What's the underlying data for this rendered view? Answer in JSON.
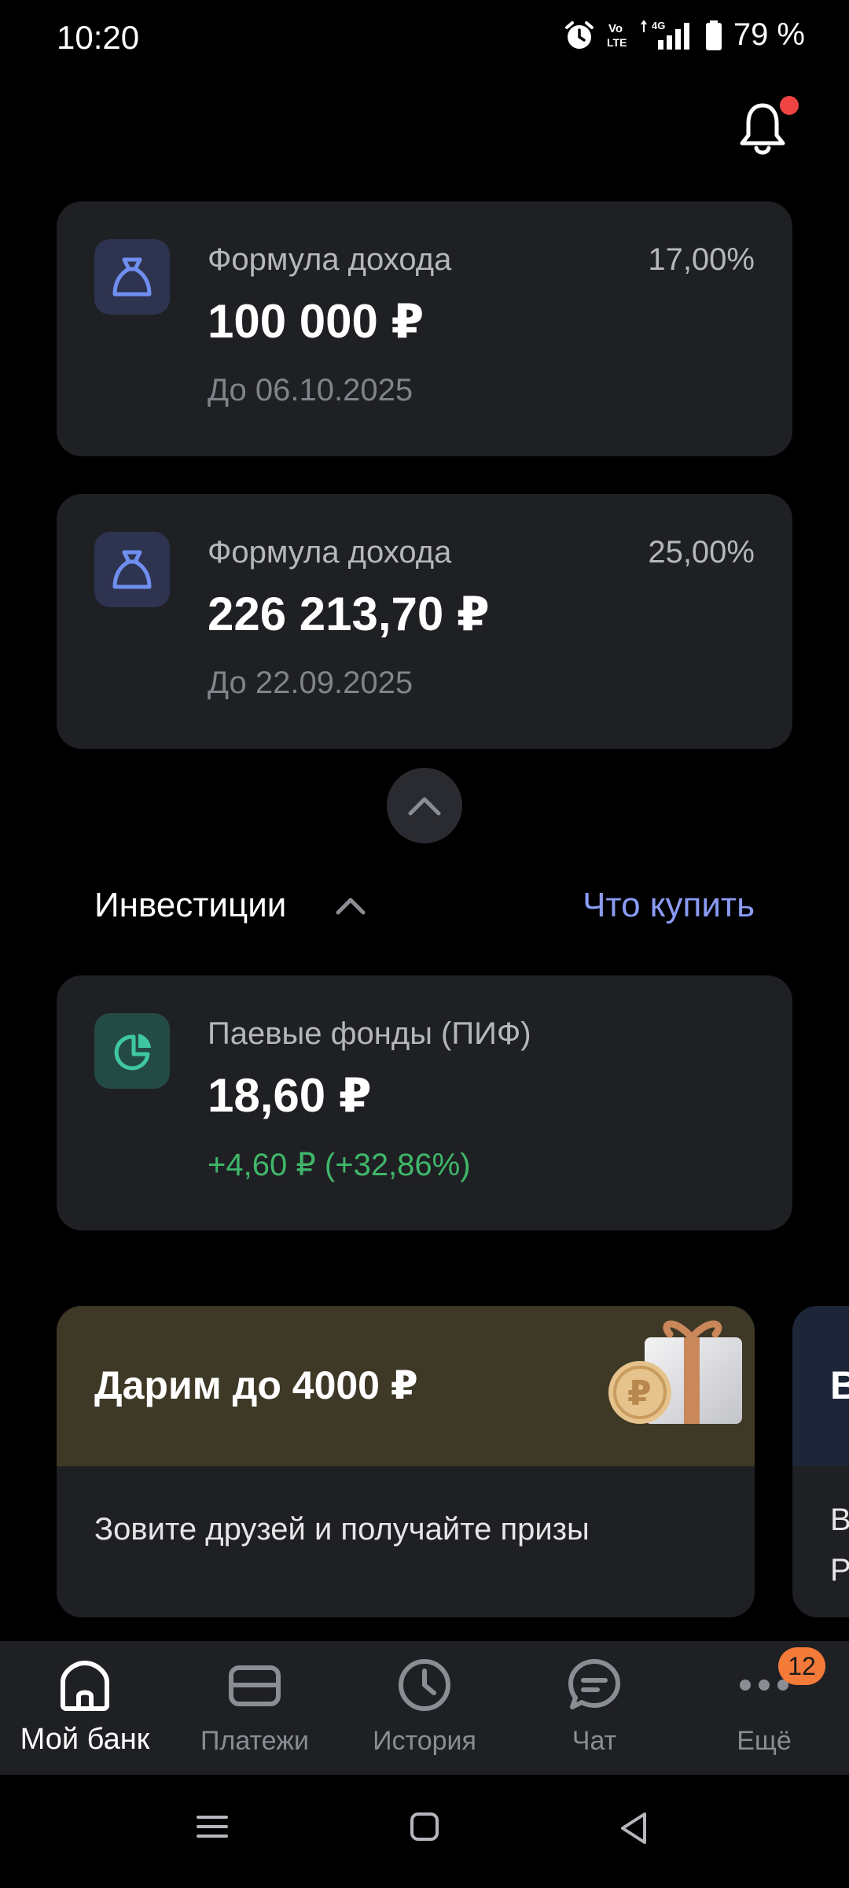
{
  "status_bar": {
    "time": "10:20",
    "battery": "79 %",
    "icons": [
      "alarm-icon",
      "volte-icon",
      "4g-signal-icon",
      "battery-icon"
    ]
  },
  "header": {
    "notification_icon": "bell-icon",
    "has_unread": true
  },
  "deposits": [
    {
      "icon": "money-bag-icon",
      "label": "Формула дохода",
      "rate": "17,00%",
      "amount": "100 000 ₽",
      "until": "До 06.10.2025"
    },
    {
      "icon": "money-bag-icon",
      "label": "Формула дохода",
      "rate": "25,00%",
      "amount": "226 213,70 ₽",
      "until": "До 22.09.2025"
    }
  ],
  "investments": {
    "title": "Инвестиции",
    "link": "Что купить",
    "fund": {
      "icon": "pie-chart-icon",
      "label": "Паевые фонды (ПИФ)",
      "amount": "18,60 ₽",
      "change": "+4,60 ₽ (+32,86%)"
    }
  },
  "promos": [
    {
      "title": "Дарим до 4000 ₽",
      "body": "Зовите друзей и получайте призы"
    },
    {
      "title": "В",
      "body": "В Р"
    }
  ],
  "bottom_nav": {
    "items": [
      {
        "label": "Мой банк",
        "icon": "home-icon",
        "active": true
      },
      {
        "label": "Платежи",
        "icon": "card-icon"
      },
      {
        "label": "История",
        "icon": "clock-icon"
      },
      {
        "label": "Чат",
        "icon": "chat-icon"
      },
      {
        "label": "Ещё",
        "icon": "more-icon",
        "badge": "12"
      }
    ]
  },
  "colors": {
    "accent_link": "#8b9cf5",
    "gain": "#3fb86a",
    "badge": "#f47a3a",
    "card_bg": "#1f2024"
  }
}
